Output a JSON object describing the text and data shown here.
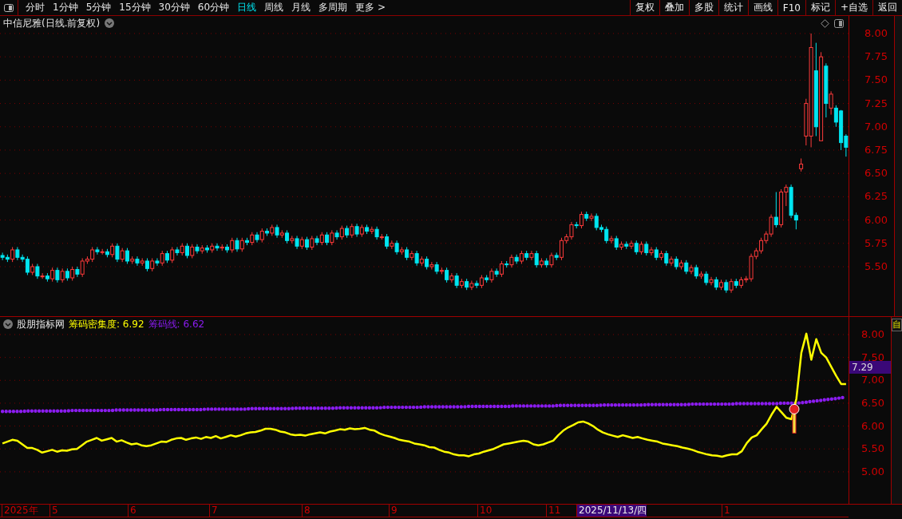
{
  "toolbar": {
    "periods": [
      {
        "label": "分时",
        "selected": false
      },
      {
        "label": "1分钟",
        "selected": false
      },
      {
        "label": "5分钟",
        "selected": false
      },
      {
        "label": "15分钟",
        "selected": false
      },
      {
        "label": "30分钟",
        "selected": false
      },
      {
        "label": "60分钟",
        "selected": false
      },
      {
        "label": "日线",
        "selected": true
      },
      {
        "label": "周线",
        "selected": false
      },
      {
        "label": "月线",
        "selected": false
      },
      {
        "label": "多周期",
        "selected": false
      },
      {
        "label": "更多 >",
        "selected": false
      }
    ],
    "actions": [
      "复权",
      "叠加",
      "多股",
      "统计",
      "画线",
      "F10",
      "标记",
      "+自选",
      "返回"
    ]
  },
  "main_chart": {
    "title": "中信尼雅(日线.前复权)",
    "chart_data": {
      "type": "candlestick",
      "ylim": [
        4.969,
        8.188
      ],
      "grid": true,
      "yticks": [
        {
          "value": 8,
          "label": "8.00"
        },
        {
          "value": 7.75,
          "label": "7.75"
        },
        {
          "value": 7.5,
          "label": "7.50"
        },
        {
          "value": 7.25,
          "label": "7.25"
        },
        {
          "value": 7,
          "label": "7.00"
        },
        {
          "value": 6.75,
          "label": "6.75"
        },
        {
          "value": 6.5,
          "label": "6.50"
        },
        {
          "value": 6.25,
          "label": "6.25"
        },
        {
          "value": 6,
          "label": "6.00"
        },
        {
          "value": 5.75,
          "label": "5.75"
        },
        {
          "value": 5.5,
          "label": "5.50"
        }
      ],
      "categories": [
        null,
        null,
        null,
        null,
        null,
        null,
        null,
        null,
        null,
        null,
        null,
        null,
        null,
        null,
        null,
        null,
        null,
        null,
        null,
        null,
        null,
        null,
        null,
        null,
        null,
        null,
        null,
        null,
        null,
        null,
        null,
        null,
        null,
        null,
        null,
        null,
        null,
        null,
        null,
        null,
        null,
        null,
        null,
        null,
        null,
        null,
        null,
        null,
        null,
        null,
        null,
        null,
        null,
        null,
        null,
        null,
        null,
        null,
        null,
        null,
        null,
        null,
        null,
        null,
        null,
        null,
        null,
        null,
        null,
        null,
        null,
        null,
        null,
        null,
        null,
        null,
        null,
        null,
        null,
        null,
        null,
        null,
        null,
        null,
        null,
        null,
        null,
        null,
        null,
        null,
        null,
        null,
        null,
        null,
        null,
        null,
        null,
        null,
        null,
        null,
        null,
        null,
        null,
        null,
        null,
        null,
        null,
        null,
        null,
        null,
        null,
        null,
        null,
        null,
        null,
        null,
        null,
        null,
        null,
        null,
        null,
        null,
        null,
        null,
        null,
        null,
        null,
        null,
        null,
        null,
        null,
        null,
        null,
        null,
        null,
        null,
        null,
        null,
        null,
        null,
        null,
        null,
        null,
        null,
        null,
        null,
        null,
        null,
        null,
        null,
        null,
        null,
        null,
        null,
        null,
        null,
        null,
        null,
        null,
        null,
        null,
        null,
        null,
        null,
        null,
        null,
        null,
        null,
        null,
        null
      ],
      "ohlc": [
        [
          5.62,
          5.65,
          5.57,
          5.6
        ],
        [
          5.6,
          5.63,
          5.55,
          5.58
        ],
        [
          5.58,
          5.71,
          5.55,
          5.68
        ],
        [
          5.68,
          5.71,
          5.57,
          5.6
        ],
        [
          5.6,
          5.63,
          5.55,
          5.58
        ],
        [
          5.58,
          5.61,
          5.41,
          5.44
        ],
        [
          5.44,
          5.53,
          5.41,
          5.5
        ],
        [
          5.5,
          5.53,
          5.37,
          5.4
        ],
        [
          5.4,
          5.43,
          5.37,
          5.4
        ],
        [
          5.4,
          5.43,
          5.34,
          5.37
        ],
        [
          5.37,
          5.49,
          5.34,
          5.46
        ],
        [
          5.46,
          5.49,
          5.33,
          5.36
        ],
        [
          5.36,
          5.48,
          5.33,
          5.45
        ],
        [
          5.45,
          5.48,
          5.35,
          5.38
        ],
        [
          5.38,
          5.5,
          5.35,
          5.47
        ],
        [
          5.47,
          5.5,
          5.39,
          5.42
        ],
        [
          5.42,
          5.59,
          5.39,
          5.56
        ],
        [
          5.56,
          5.61,
          5.53,
          5.58
        ],
        [
          5.58,
          5.71,
          5.55,
          5.68
        ],
        [
          5.68,
          5.71,
          5.63,
          5.66
        ],
        [
          5.66,
          5.69,
          5.63,
          5.66
        ],
        [
          5.66,
          5.69,
          5.6,
          5.63
        ],
        [
          5.63,
          5.75,
          5.6,
          5.72
        ],
        [
          5.72,
          5.75,
          5.55,
          5.58
        ],
        [
          5.58,
          5.7,
          5.55,
          5.67
        ],
        [
          5.67,
          5.7,
          5.53,
          5.56
        ],
        [
          5.56,
          5.61,
          5.53,
          5.58
        ],
        [
          5.58,
          5.61,
          5.51,
          5.54
        ],
        [
          5.54,
          5.59,
          5.51,
          5.56
        ],
        [
          5.56,
          5.59,
          5.45,
          5.48
        ],
        [
          5.48,
          5.59,
          5.45,
          5.56
        ],
        [
          5.56,
          5.59,
          5.51,
          5.54
        ],
        [
          5.54,
          5.67,
          5.51,
          5.64
        ],
        [
          5.64,
          5.67,
          5.54,
          5.57
        ],
        [
          5.57,
          5.71,
          5.54,
          5.68
        ],
        [
          5.68,
          5.71,
          5.62,
          5.65
        ],
        [
          5.65,
          5.75,
          5.62,
          5.72
        ],
        [
          5.72,
          5.75,
          5.59,
          5.62
        ],
        [
          5.62,
          5.74,
          5.59,
          5.71
        ],
        [
          5.71,
          5.74,
          5.64,
          5.67
        ],
        [
          5.67,
          5.73,
          5.64,
          5.7
        ],
        [
          5.7,
          5.73,
          5.65,
          5.68
        ],
        [
          5.68,
          5.75,
          5.65,
          5.72
        ],
        [
          5.72,
          5.75,
          5.67,
          5.7
        ],
        [
          5.7,
          5.74,
          5.67,
          5.71
        ],
        [
          5.71,
          5.74,
          5.65,
          5.68
        ],
        [
          5.68,
          5.81,
          5.65,
          5.78
        ],
        [
          5.78,
          5.81,
          5.66,
          5.69
        ],
        [
          5.69,
          5.81,
          5.66,
          5.78
        ],
        [
          5.78,
          5.81,
          5.73,
          5.76
        ],
        [
          5.76,
          5.87,
          5.73,
          5.84
        ],
        [
          5.84,
          5.87,
          5.76,
          5.79
        ],
        [
          5.79,
          5.91,
          5.76,
          5.88
        ],
        [
          5.88,
          5.91,
          5.83,
          5.86
        ],
        [
          5.86,
          5.95,
          5.83,
          5.92
        ],
        [
          5.92,
          5.95,
          5.81,
          5.84
        ],
        [
          5.84,
          5.89,
          5.81,
          5.86
        ],
        [
          5.86,
          5.89,
          5.75,
          5.78
        ],
        [
          5.78,
          5.83,
          5.75,
          5.8
        ],
        [
          5.8,
          5.83,
          5.69,
          5.72
        ],
        [
          5.72,
          5.82,
          5.69,
          5.79
        ],
        [
          5.79,
          5.82,
          5.68,
          5.71
        ],
        [
          5.71,
          5.83,
          5.68,
          5.8
        ],
        [
          5.8,
          5.83,
          5.73,
          5.76
        ],
        [
          5.76,
          5.87,
          5.73,
          5.84
        ],
        [
          5.84,
          5.87,
          5.73,
          5.76
        ],
        [
          5.76,
          5.89,
          5.73,
          5.86
        ],
        [
          5.86,
          5.89,
          5.79,
          5.82
        ],
        [
          5.82,
          5.94,
          5.79,
          5.91
        ],
        [
          5.91,
          5.94,
          5.81,
          5.84
        ],
        [
          5.84,
          5.96,
          5.81,
          5.93
        ],
        [
          5.93,
          5.96,
          5.82,
          5.85
        ],
        [
          5.85,
          5.95,
          5.82,
          5.92
        ],
        [
          5.92,
          5.95,
          5.85,
          5.88
        ],
        [
          5.88,
          5.93,
          5.85,
          5.9
        ],
        [
          5.9,
          5.93,
          5.79,
          5.82
        ],
        [
          5.82,
          5.85,
          5.79,
          5.82
        ],
        [
          5.82,
          5.85,
          5.69,
          5.72
        ],
        [
          5.72,
          5.78,
          5.69,
          5.75
        ],
        [
          5.75,
          5.78,
          5.63,
          5.66
        ],
        [
          5.66,
          5.71,
          5.63,
          5.68
        ],
        [
          5.68,
          5.71,
          5.57,
          5.6
        ],
        [
          5.6,
          5.67,
          5.57,
          5.64
        ],
        [
          5.64,
          5.67,
          5.51,
          5.54
        ],
        [
          5.54,
          5.61,
          5.51,
          5.58
        ],
        [
          5.58,
          5.61,
          5.47,
          5.5
        ],
        [
          5.5,
          5.55,
          5.47,
          5.52
        ],
        [
          5.52,
          5.55,
          5.42,
          5.45
        ],
        [
          5.45,
          5.49,
          5.42,
          5.46
        ],
        [
          5.46,
          5.49,
          5.33,
          5.36
        ],
        [
          5.36,
          5.43,
          5.33,
          5.4
        ],
        [
          5.4,
          5.43,
          5.27,
          5.3
        ],
        [
          5.3,
          5.37,
          5.27,
          5.34
        ],
        [
          5.34,
          5.37,
          5.25,
          5.28
        ],
        [
          5.28,
          5.35,
          5.25,
          5.32
        ],
        [
          5.32,
          5.35,
          5.27,
          5.3
        ],
        [
          5.3,
          5.41,
          5.27,
          5.38
        ],
        [
          5.38,
          5.41,
          5.33,
          5.36
        ],
        [
          5.36,
          5.48,
          5.33,
          5.45
        ],
        [
          5.45,
          5.48,
          5.39,
          5.42
        ],
        [
          5.42,
          5.56,
          5.39,
          5.53
        ],
        [
          5.53,
          5.56,
          5.49,
          5.52
        ],
        [
          5.52,
          5.63,
          5.49,
          5.6
        ],
        [
          5.6,
          5.63,
          5.53,
          5.56
        ],
        [
          5.56,
          5.67,
          5.53,
          5.64
        ],
        [
          5.64,
          5.67,
          5.57,
          5.6
        ],
        [
          5.6,
          5.67,
          5.57,
          5.64
        ],
        [
          5.64,
          5.67,
          5.49,
          5.52
        ],
        [
          5.52,
          5.59,
          5.49,
          5.56
        ],
        [
          5.56,
          5.59,
          5.49,
          5.52
        ],
        [
          5.52,
          5.65,
          5.49,
          5.62
        ],
        [
          5.62,
          5.65,
          5.57,
          5.6
        ],
        [
          5.6,
          5.81,
          5.57,
          5.78
        ],
        [
          5.78,
          5.85,
          5.75,
          5.82
        ],
        [
          5.82,
          5.98,
          5.79,
          5.95
        ],
        [
          5.95,
          5.98,
          5.91,
          5.94
        ],
        [
          5.94,
          6.09,
          5.91,
          6.06
        ],
        [
          6.06,
          6.09,
          5.99,
          6.02
        ],
        [
          6.02,
          6.07,
          5.99,
          6.04
        ],
        [
          6.04,
          6.07,
          5.89,
          5.92
        ],
        [
          5.92,
          5.95,
          5.87,
          5.9
        ],
        [
          5.9,
          5.93,
          5.75,
          5.78
        ],
        [
          5.78,
          5.83,
          5.75,
          5.8
        ],
        [
          5.8,
          5.83,
          5.68,
          5.71
        ],
        [
          5.71,
          5.77,
          5.68,
          5.74
        ],
        [
          5.74,
          5.77,
          5.69,
          5.72
        ],
        [
          5.72,
          5.78,
          5.69,
          5.75
        ],
        [
          5.75,
          5.78,
          5.63,
          5.66
        ],
        [
          5.66,
          5.77,
          5.63,
          5.74
        ],
        [
          5.74,
          5.77,
          5.62,
          5.65
        ],
        [
          5.65,
          5.71,
          5.62,
          5.68
        ],
        [
          5.68,
          5.71,
          5.57,
          5.6
        ],
        [
          5.6,
          5.67,
          5.57,
          5.64
        ],
        [
          5.64,
          5.67,
          5.51,
          5.54
        ],
        [
          5.54,
          5.61,
          5.51,
          5.58
        ],
        [
          5.58,
          5.61,
          5.47,
          5.5
        ],
        [
          5.5,
          5.57,
          5.47,
          5.54
        ],
        [
          5.54,
          5.57,
          5.42,
          5.45
        ],
        [
          5.45,
          5.52,
          5.42,
          5.49
        ],
        [
          5.49,
          5.52,
          5.37,
          5.4
        ],
        [
          5.4,
          5.45,
          5.37,
          5.42
        ],
        [
          5.42,
          5.45,
          5.3,
          5.33
        ],
        [
          5.33,
          5.39,
          5.3,
          5.36
        ],
        [
          5.36,
          5.39,
          5.25,
          5.28
        ],
        [
          5.28,
          5.36,
          5.25,
          5.33
        ],
        [
          5.33,
          5.36,
          5.22,
          5.25
        ],
        [
          5.25,
          5.37,
          5.22,
          5.34
        ],
        [
          5.34,
          5.37,
          5.27,
          5.3
        ],
        [
          5.3,
          5.39,
          5.27,
          5.36
        ],
        [
          5.36,
          5.4,
          5.33,
          5.37
        ],
        [
          5.37,
          5.64,
          5.34,
          5.61
        ],
        [
          5.61,
          5.7,
          5.58,
          5.67
        ],
        [
          5.67,
          5.81,
          5.64,
          5.78
        ],
        [
          5.78,
          5.88,
          5.75,
          5.85
        ],
        [
          5.85,
          6.06,
          5.82,
          6.03
        ],
        [
          6.03,
          6.3,
          5.92,
          5.95
        ],
        [
          5.95,
          6.33,
          5.92,
          6.3
        ],
        [
          6.3,
          6.38,
          6.15,
          6.35
        ],
        [
          6.35,
          6.38,
          6.02,
          6.05
        ],
        [
          6.05,
          6.08,
          5.9,
          6.0
        ],
        [
          6.55,
          6.66,
          6.52,
          6.6
        ],
        [
          6.9,
          7.3,
          6.8,
          7.25
        ],
        [
          6.9,
          8.0,
          6.78,
          7.85
        ],
        [
          7.6,
          7.9,
          6.9,
          7.0
        ],
        [
          6.85,
          7.8,
          6.85,
          7.75
        ],
        [
          7.65,
          7.68,
          7.1,
          7.25
        ],
        [
          7.2,
          7.38,
          7.13,
          7.35
        ],
        [
          7.2,
          7.23,
          7.0,
          7.05
        ],
        [
          7.17,
          7.18,
          6.75,
          6.83
        ],
        [
          6.9,
          6.92,
          6.68,
          6.78
        ]
      ]
    }
  },
  "indicator": {
    "name": "股朋指标网",
    "legend_values": [
      "6.92",
      "6.62"
    ],
    "cursor_value": "7.29",
    "chart_data": {
      "type": "line",
      "ylim": [
        4.3,
        8.384
      ],
      "grid": true,
      "yticks": [
        {
          "value": 8,
          "label": "8.00"
        },
        {
          "value": 7.5,
          "label": "7.50"
        },
        {
          "value": 7,
          "label": "7.00"
        },
        {
          "value": 6.5,
          "label": "6.50"
        },
        {
          "value": 6,
          "label": "6.00"
        },
        {
          "value": 5.5,
          "label": "5.50"
        },
        {
          "value": 5,
          "label": "5.00"
        }
      ],
      "categories": [
        null,
        null,
        null,
        null,
        null,
        null,
        null,
        null,
        null,
        null,
        null,
        null,
        null,
        null,
        null,
        null,
        null,
        null,
        null,
        null,
        null,
        null,
        null,
        null,
        null,
        null,
        null,
        null,
        null,
        null,
        null,
        null,
        null,
        null,
        null,
        null,
        null,
        null,
        null,
        null,
        null,
        null,
        null,
        null,
        null,
        null,
        null,
        null,
        null,
        null,
        null,
        null,
        null,
        null,
        null,
        null,
        null,
        null,
        null,
        null,
        null,
        null,
        null,
        null,
        null,
        null,
        null,
        null,
        null,
        null,
        null,
        null,
        null,
        null,
        null,
        null,
        null,
        null,
        null,
        null,
        null,
        null,
        null,
        null,
        null,
        null,
        null,
        null,
        null,
        null,
        null,
        null,
        null,
        null,
        null,
        null,
        null,
        null,
        null,
        null,
        null,
        null,
        null,
        null,
        null,
        null,
        null,
        null,
        null,
        null,
        null,
        null,
        null,
        null,
        null,
        null,
        null,
        null,
        null,
        null,
        null,
        null,
        null,
        null,
        null,
        null,
        null,
        null,
        null,
        null,
        null,
        null,
        null,
        null,
        null,
        null,
        null,
        null,
        null,
        null,
        null,
        null,
        null,
        null,
        null,
        null,
        null,
        null,
        null,
        null,
        null,
        null,
        null,
        null,
        null,
        null,
        null,
        null,
        null,
        null,
        null,
        null,
        null,
        null,
        null,
        null,
        null,
        null,
        null,
        null,
        null
      ],
      "series": [
        {
          "name": "筹码密集度:",
          "color": "#ffff00",
          "values": [
            5.62,
            5.66,
            5.7,
            5.68,
            5.6,
            5.52,
            5.52,
            5.48,
            5.42,
            5.45,
            5.48,
            5.44,
            5.47,
            5.46,
            5.49,
            5.5,
            5.58,
            5.66,
            5.7,
            5.74,
            5.68,
            5.71,
            5.74,
            5.66,
            5.69,
            5.64,
            5.6,
            5.62,
            5.58,
            5.56,
            5.58,
            5.62,
            5.66,
            5.65,
            5.7,
            5.73,
            5.74,
            5.7,
            5.73,
            5.75,
            5.72,
            5.76,
            5.74,
            5.78,
            5.73,
            5.76,
            5.8,
            5.77,
            5.8,
            5.84,
            5.86,
            5.87,
            5.9,
            5.94,
            5.94,
            5.92,
            5.88,
            5.86,
            5.82,
            5.8,
            5.81,
            5.79,
            5.82,
            5.84,
            5.86,
            5.84,
            5.88,
            5.9,
            5.93,
            5.92,
            5.95,
            5.93,
            5.94,
            5.96,
            5.92,
            5.9,
            5.84,
            5.8,
            5.77,
            5.74,
            5.7,
            5.68,
            5.66,
            5.62,
            5.6,
            5.58,
            5.54,
            5.53,
            5.48,
            5.44,
            5.42,
            5.38,
            5.36,
            5.36,
            5.34,
            5.38,
            5.4,
            5.44,
            5.47,
            5.5,
            5.55,
            5.6,
            5.62,
            5.64,
            5.66,
            5.68,
            5.66,
            5.6,
            5.58,
            5.6,
            5.64,
            5.68,
            5.8,
            5.9,
            5.97,
            6.02,
            6.08,
            6.1,
            6.06,
            6,
            5.92,
            5.86,
            5.82,
            5.79,
            5.76,
            5.8,
            5.77,
            5.74,
            5.76,
            5.73,
            5.7,
            5.68,
            5.66,
            5.62,
            5.6,
            5.58,
            5.56,
            5.53,
            5.51,
            5.48,
            5.44,
            5.41,
            5.38,
            5.36,
            5.35,
            5.33,
            5.36,
            5.38,
            5.38,
            5.45,
            5.63,
            5.75,
            5.8,
            5.93,
            6.05,
            6.25,
            6.42,
            6.3,
            6.18,
            6.15,
            6.6,
            7.6,
            8.02,
            7.45,
            7.9,
            7.6,
            7.5,
            7.3,
            7.1,
            6.92,
            6.92
          ]
        },
        {
          "name": "筹码线:",
          "color": "#8b1cf0",
          "line_style": "dotted",
          "values": [
            6.32,
            6.32,
            6.32,
            6.32,
            6.32,
            6.33,
            6.33,
            6.33,
            6.33,
            6.33,
            6.33,
            6.33,
            6.33,
            6.33,
            6.34,
            6.34,
            6.34,
            6.34,
            6.34,
            6.34,
            6.34,
            6.34,
            6.34,
            6.35,
            6.35,
            6.35,
            6.35,
            6.35,
            6.35,
            6.35,
            6.35,
            6.35,
            6.36,
            6.36,
            6.36,
            6.36,
            6.36,
            6.36,
            6.36,
            6.36,
            6.36,
            6.37,
            6.37,
            6.37,
            6.37,
            6.37,
            6.37,
            6.37,
            6.37,
            6.37,
            6.38,
            6.38,
            6.38,
            6.38,
            6.38,
            6.38,
            6.38,
            6.38,
            6.38,
            6.39,
            6.39,
            6.39,
            6.39,
            6.39,
            6.39,
            6.39,
            6.39,
            6.39,
            6.4,
            6.4,
            6.4,
            6.4,
            6.4,
            6.4,
            6.4,
            6.4,
            6.4,
            6.41,
            6.41,
            6.41,
            6.41,
            6.41,
            6.41,
            6.41,
            6.41,
            6.42,
            6.42,
            6.42,
            6.42,
            6.42,
            6.42,
            6.42,
            6.42,
            6.42,
            6.43,
            6.43,
            6.43,
            6.43,
            6.43,
            6.43,
            6.43,
            6.43,
            6.43,
            6.44,
            6.44,
            6.44,
            6.44,
            6.44,
            6.44,
            6.44,
            6.44,
            6.44,
            6.45,
            6.45,
            6.45,
            6.45,
            6.45,
            6.45,
            6.45,
            6.45,
            6.45,
            6.46,
            6.46,
            6.46,
            6.46,
            6.46,
            6.46,
            6.46,
            6.46,
            6.46,
            6.47,
            6.47,
            6.47,
            6.47,
            6.47,
            6.47,
            6.47,
            6.47,
            6.47,
            6.48,
            6.48,
            6.48,
            6.48,
            6.48,
            6.48,
            6.48,
            6.48,
            6.48,
            6.49,
            6.49,
            6.49,
            6.49,
            6.49,
            6.49,
            6.49,
            6.49,
            6.49,
            6.5,
            6.5,
            6.5,
            6.5,
            6.51,
            6.52,
            6.54,
            6.55,
            6.56,
            6.58,
            6.59,
            6.6,
            6.62,
            6.63
          ]
        }
      ]
    }
  },
  "time_axis": {
    "labels": [
      {
        "text": "2025年",
        "selected": false
      },
      {
        "text": "5",
        "selected": false
      },
      {
        "text": "6",
        "selected": false
      },
      {
        "text": "7",
        "selected": false
      },
      {
        "text": "8",
        "selected": false
      },
      {
        "text": "9",
        "selected": false
      },
      {
        "text": "10",
        "selected": false
      },
      {
        "text": "11",
        "selected": false
      },
      {
        "text": "2025/11/13/四",
        "selected": true
      },
      {
        "text": "1",
        "selected": false
      }
    ]
  },
  "side_tab": "自"
}
